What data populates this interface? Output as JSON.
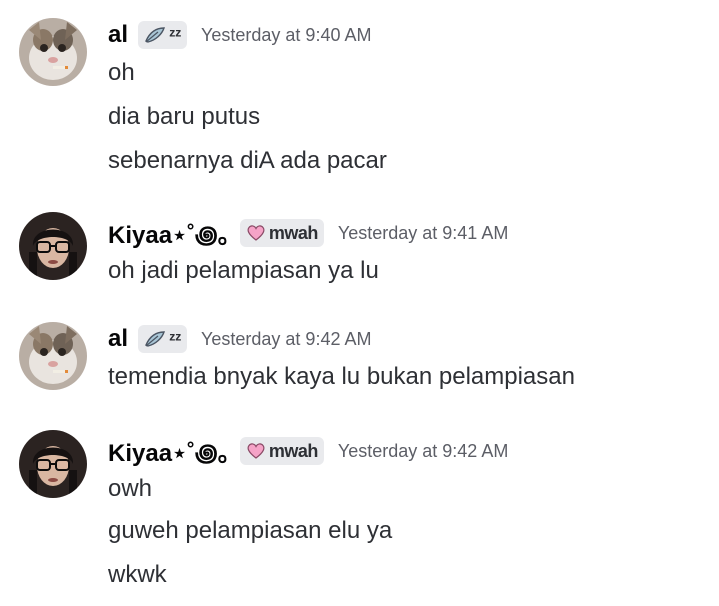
{
  "messages": [
    {
      "author": "al",
      "tag": "ᶻᶻ",
      "timestamp": "Yesterday at 9:40 AM",
      "lines": [
        "oh",
        "dia baru putus",
        "sebenarnya diA ada pacar"
      ]
    },
    {
      "author": "Kiyaa⋆˚꩜｡",
      "tag": "mwah",
      "timestamp": "Yesterday at 9:41 AM",
      "lines": [
        "oh jadi pelampiasan ya lu"
      ]
    },
    {
      "author": "al",
      "tag": "ᶻᶻ",
      "timestamp": "Yesterday at 9:42 AM",
      "lines": [
        "temendia bnyak kaya lu bukan pelampiasan"
      ]
    },
    {
      "author": "Kiyaa⋆˚꩜｡",
      "tag": "mwah",
      "timestamp": "Yesterday at 9:42 AM",
      "lines": [
        "owh",
        "guweh pelampiasan elu ya",
        "wkwk"
      ]
    }
  ],
  "colors": {
    "username": "#060607",
    "message_text": "#2e3035",
    "timestamp": "#5c5e66",
    "tag_bg": "#e9eaed",
    "heart": "#f5a3c7"
  },
  "icons": {
    "al_tag": "feather-icon",
    "kiyaa_tag": "heart-icon"
  }
}
